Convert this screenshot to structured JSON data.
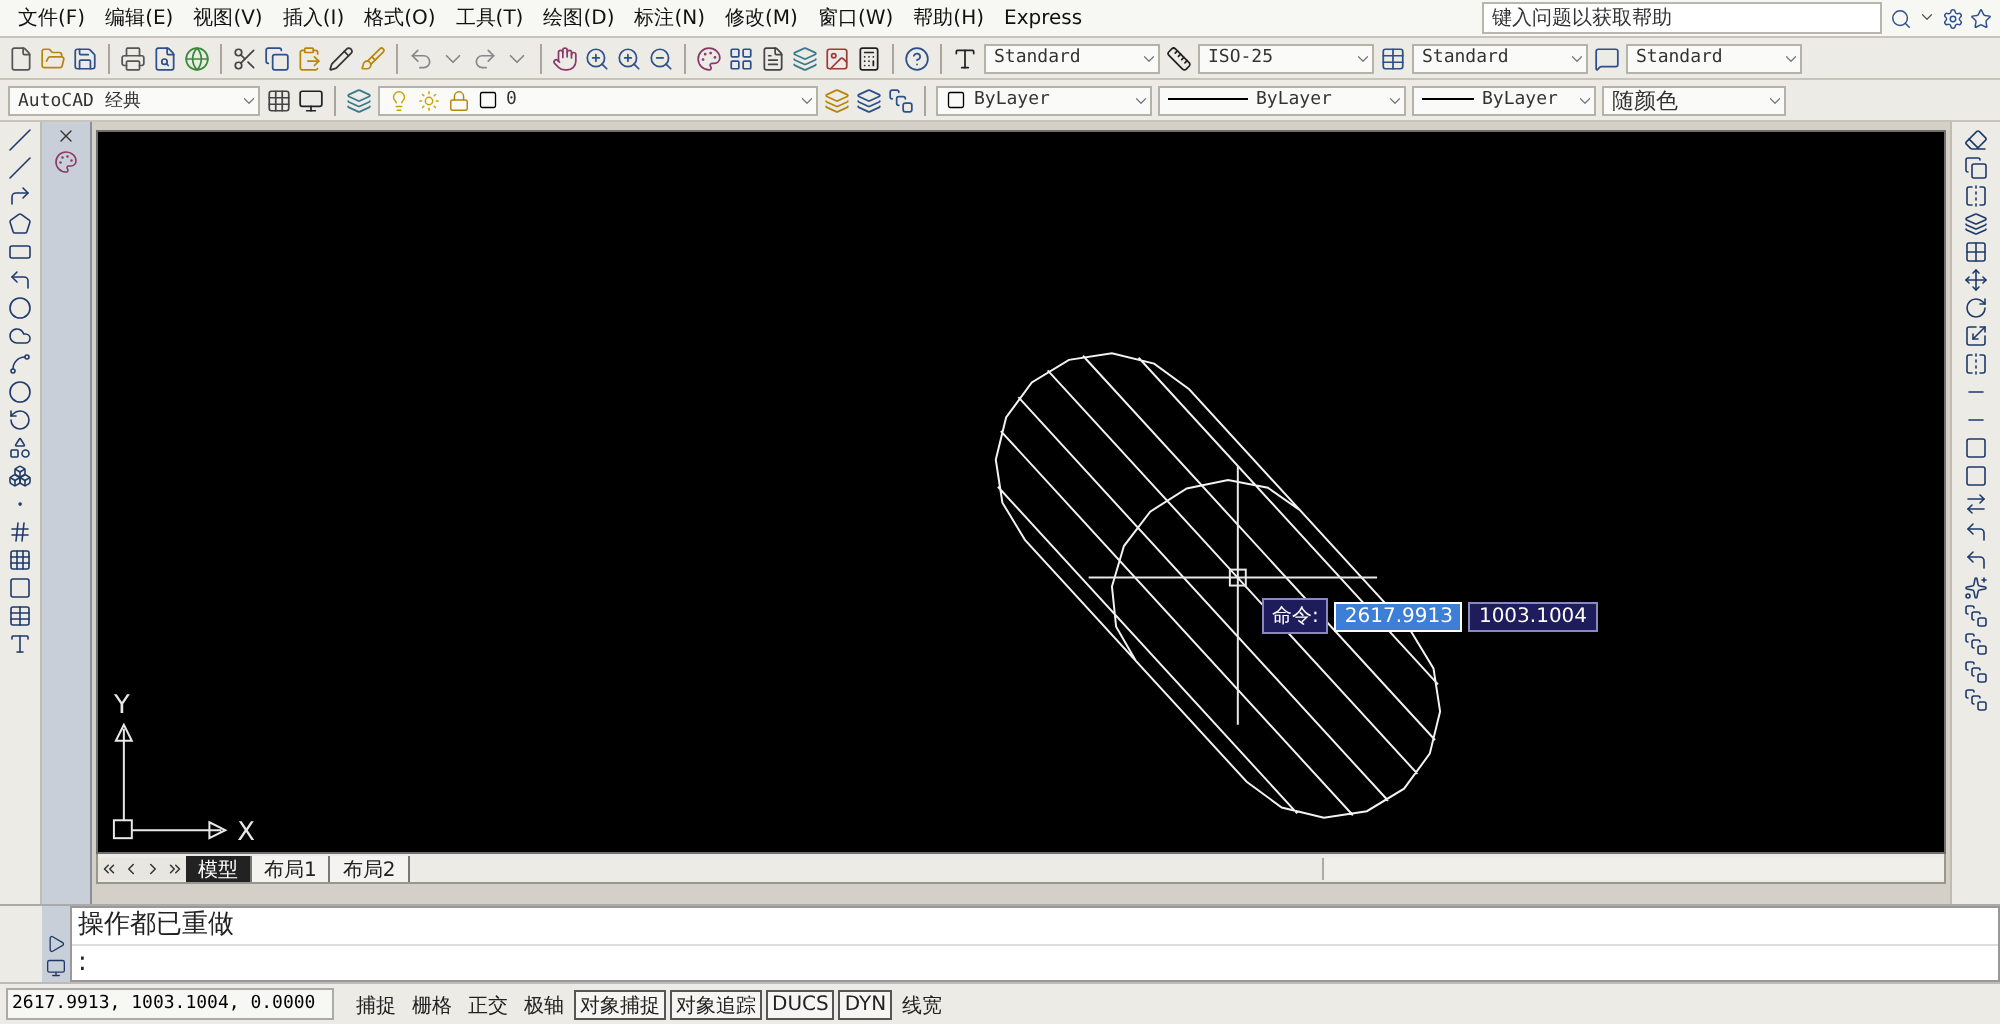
{
  "menu": [
    "文件(F)",
    "编辑(E)",
    "视图(V)",
    "插入(I)",
    "格式(O)",
    "工具(T)",
    "绘图(D)",
    "标注(N)",
    "修改(M)",
    "窗口(W)",
    "帮助(H)",
    "Express"
  ],
  "help_search": {
    "placeholder": "键入问题以获取帮助"
  },
  "style_toolbar": {
    "text_style": "Standard",
    "dimension_style": "ISO-25",
    "table_style": "Standard",
    "multileader_style": "Standard"
  },
  "workspace": "AutoCAD 经典",
  "layer": "0",
  "properties": {
    "color_setting": "ByLayer",
    "linetype": "ByLayer",
    "lineweight": "ByLayer",
    "plot_style": "随颜色"
  },
  "canvas": {
    "ucs_y": "Y",
    "ucs_x": "X",
    "dynamic_input": {
      "label": "命令:",
      "x_value": "2617.9913",
      "y_value": "1003.1004"
    }
  },
  "layout_tabs": [
    {
      "label": "模型",
      "selected": true
    },
    {
      "label": "布局1",
      "selected": false
    },
    {
      "label": "布局2",
      "selected": false
    }
  ],
  "command_lines": [
    "操作都已重做",
    ":"
  ],
  "status_bar": {
    "coordinates": "2617.9913, 1003.1004, 0.0000",
    "toggles": [
      {
        "label": "捕捉",
        "on": false
      },
      {
        "label": "栅格",
        "on": false
      },
      {
        "label": "正交",
        "on": false
      },
      {
        "label": "极轴",
        "on": false
      },
      {
        "label": "对象捕捉",
        "on": true
      },
      {
        "label": "对象追踪",
        "on": true
      },
      {
        "label": "DUCS",
        "on": true
      },
      {
        "label": "DYN",
        "on": true
      },
      {
        "label": "线宽",
        "on": false
      }
    ]
  }
}
